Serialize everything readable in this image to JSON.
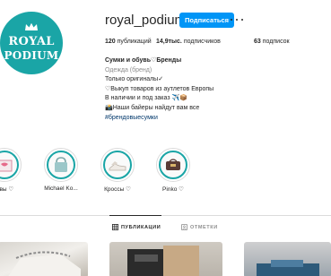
{
  "profile": {
    "username": "royal_podium",
    "follow_label": "Подписаться",
    "more_icon": "more-horizontal-icon",
    "avatar_text_line1": "ROYAL",
    "avatar_text_line2": "PODIUM",
    "accent_color": "#1aa5a6",
    "button_color": "#0095f6"
  },
  "stats": {
    "posts_value": "120",
    "posts_label": "публикаций",
    "followers_value": "14,9тыс.",
    "followers_label": "подписчиков",
    "following_value": "63",
    "following_label": "подписок"
  },
  "bio": {
    "name": "Сумки и обувь♡Бренды",
    "category": "Одежда (бренд)",
    "line1": "Только оригиналы✓",
    "line2": "♡Выкуп товаров из аутлетов Европы",
    "line3": "В наличии и под заказ ✈️📦",
    "line4": "📸Наши байеры найдут вам все",
    "hashtag": "#брендовыесумки"
  },
  "highlights": [
    {
      "label": "ывы ♡",
      "icon": "gift-box-icon"
    },
    {
      "label": "Michael Ko...",
      "icon": "handbag-icon"
    },
    {
      "label": "Кроссы ♡",
      "icon": "sneakers-icon"
    },
    {
      "label": "Pinko ♡",
      "icon": "handbag-icon"
    }
  ],
  "tabs": {
    "posts": "ПУБЛИКАЦИИ",
    "tagged": "ОТМЕТКИ"
  }
}
